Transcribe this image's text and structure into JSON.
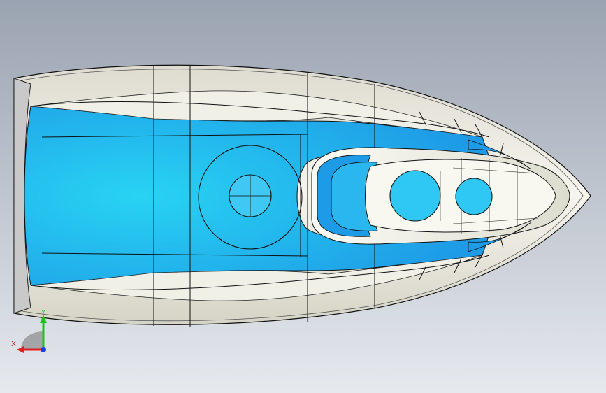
{
  "viewport": {
    "background_top": "#9aa3b1",
    "background_bottom": "#e6e9ee"
  },
  "model": {
    "body_color": "#f3f2ea",
    "inner_color": "#1e9be6",
    "inner_highlight": "#28d3f3",
    "edge_color": "#1a1a1a"
  },
  "triad": {
    "x_label": "X",
    "y_label": "Y",
    "x_color": "#e02020",
    "y_color": "#1fbf1f",
    "z_color": "#1f3fe0",
    "plane_color": "#9a9a9a"
  }
}
